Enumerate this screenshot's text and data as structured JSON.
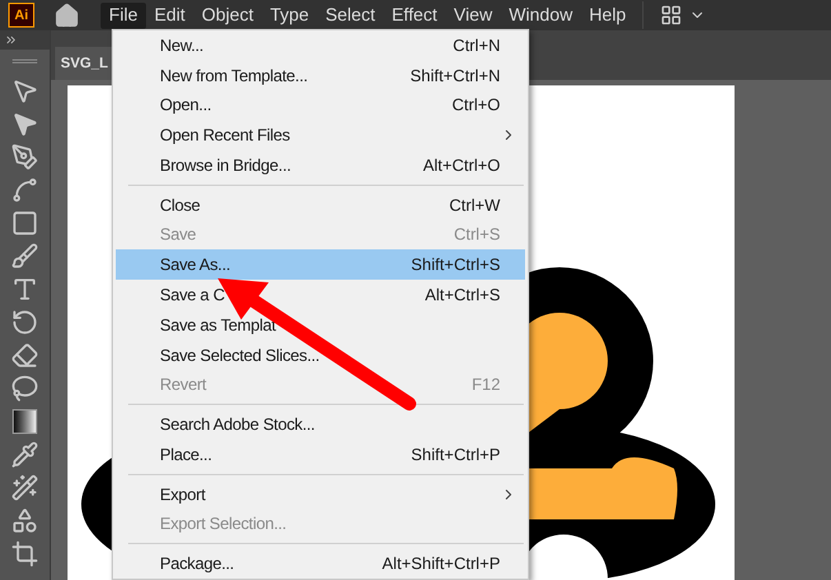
{
  "app_logo": "Ai",
  "menu_bar": [
    {
      "label": "File",
      "selected": true
    },
    {
      "label": "Edit",
      "selected": false
    },
    {
      "label": "Object",
      "selected": false
    },
    {
      "label": "Type",
      "selected": false
    },
    {
      "label": "Select",
      "selected": false
    },
    {
      "label": "Effect",
      "selected": false
    },
    {
      "label": "View",
      "selected": false
    },
    {
      "label": "Window",
      "selected": false
    },
    {
      "label": "Help",
      "selected": false
    }
  ],
  "document_tab": {
    "title": "SVG_L"
  },
  "file_menu": {
    "groups": [
      [
        {
          "label": "New...",
          "shortcut": "Ctrl+N",
          "disabled": false,
          "highlighted": false,
          "submenu": false
        },
        {
          "label": "New from Template...",
          "shortcut": "Shift+Ctrl+N",
          "disabled": false,
          "highlighted": false,
          "submenu": false
        },
        {
          "label": "Open...",
          "shortcut": "Ctrl+O",
          "disabled": false,
          "highlighted": false,
          "submenu": false
        },
        {
          "label": "Open Recent Files",
          "disabled": false,
          "highlighted": false,
          "submenu": true
        },
        {
          "label": "Browse in Bridge...",
          "shortcut": "Alt+Ctrl+O",
          "disabled": false,
          "highlighted": false,
          "submenu": false
        }
      ],
      [
        {
          "label": "Close",
          "shortcut": "Ctrl+W",
          "disabled": false,
          "highlighted": false,
          "submenu": false
        },
        {
          "label": "Save",
          "shortcut": "Ctrl+S",
          "disabled": true,
          "highlighted": false,
          "submenu": false
        },
        {
          "label": "Save As...",
          "shortcut": "Shift+Ctrl+S",
          "disabled": false,
          "highlighted": true,
          "submenu": false
        },
        {
          "label": "Save a C",
          "shortcut": "Alt+Ctrl+S",
          "disabled": false,
          "highlighted": false,
          "submenu": false
        },
        {
          "label": "Save as Templat",
          "disabled": false,
          "highlighted": false,
          "submenu": false
        },
        {
          "label": "Save Selected Slices...",
          "disabled": false,
          "highlighted": false,
          "submenu": false
        },
        {
          "label": "Revert",
          "shortcut": "F12",
          "disabled": true,
          "highlighted": false,
          "submenu": false
        }
      ],
      [
        {
          "label": "Search Adobe Stock...",
          "disabled": false,
          "highlighted": false,
          "submenu": false
        },
        {
          "label": "Place...",
          "shortcut": "Shift+Ctrl+P",
          "disabled": false,
          "highlighted": false,
          "submenu": false
        }
      ],
      [
        {
          "label": "Export",
          "disabled": false,
          "highlighted": false,
          "submenu": true
        },
        {
          "label": "Export Selection...",
          "disabled": true,
          "highlighted": false,
          "submenu": false
        }
      ],
      [
        {
          "label": "Package...",
          "shortcut": "Alt+Shift+Ctrl+P",
          "disabled": false,
          "highlighted": false,
          "submenu": false
        }
      ]
    ]
  }
}
